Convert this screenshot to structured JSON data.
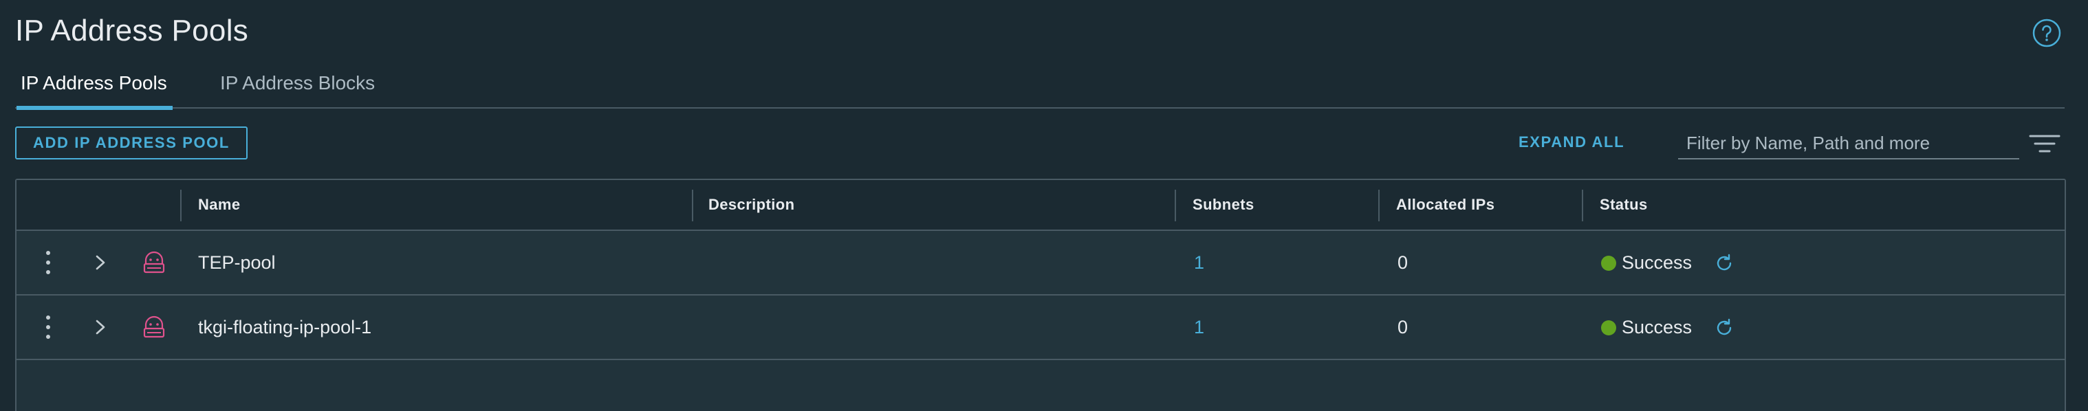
{
  "page": {
    "title": "IP Address Pools",
    "help_icon": "help-circle-icon"
  },
  "tabs": [
    {
      "label": "IP Address Pools",
      "active": true
    },
    {
      "label": "IP Address Blocks",
      "active": false
    }
  ],
  "toolbar": {
    "add_label": "ADD IP ADDRESS POOL",
    "expand_all_label": "EXPAND ALL",
    "filter_placeholder": "Filter by Name, Path and more",
    "filter_value": "",
    "filter_icon": "filter-icon"
  },
  "table": {
    "columns": [
      "Name",
      "Description",
      "Subnets",
      "Allocated IPs",
      "Status"
    ],
    "rows": [
      {
        "name": "TEP-pool",
        "description": "",
        "subnets": "1",
        "allocated_ips": "0",
        "status": "Success"
      },
      {
        "name": "tkgi-floating-ip-pool-1",
        "description": "",
        "subnets": "1",
        "allocated_ips": "0",
        "status": "Success"
      }
    ]
  },
  "colors": {
    "accent": "#49afd9",
    "success": "#62a420",
    "pool_icon": "#e1528d",
    "background": "#1b2a32"
  }
}
